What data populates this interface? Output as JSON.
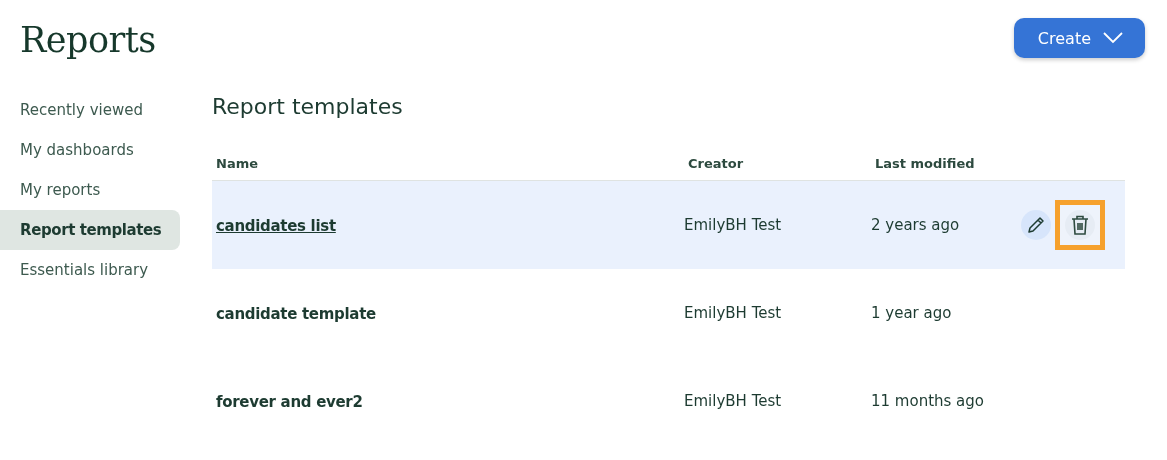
{
  "header": {
    "title": "Reports",
    "create_button": {
      "label": "Create"
    }
  },
  "sidebar": {
    "items": [
      {
        "label": "Recently viewed",
        "selected": false
      },
      {
        "label": "My dashboards",
        "selected": false
      },
      {
        "label": "My reports",
        "selected": false
      },
      {
        "label": "Report templates",
        "selected": true
      },
      {
        "label": "Essentials library",
        "selected": false
      }
    ]
  },
  "section": {
    "title": "Report templates"
  },
  "table": {
    "columns": [
      "Name",
      "Creator",
      "Last modified"
    ],
    "rows": [
      {
        "name": "candidates list",
        "creator": "EmilyBH Test",
        "modified": "2 years ago",
        "selected": true,
        "delete_highlighted": true
      },
      {
        "name": "candidate template",
        "creator": "EmilyBH Test",
        "modified": "1 year ago",
        "selected": false
      },
      {
        "name": "forever and ever2",
        "creator": "EmilyBH Test",
        "modified": "11 months ago",
        "selected": false
      }
    ]
  }
}
